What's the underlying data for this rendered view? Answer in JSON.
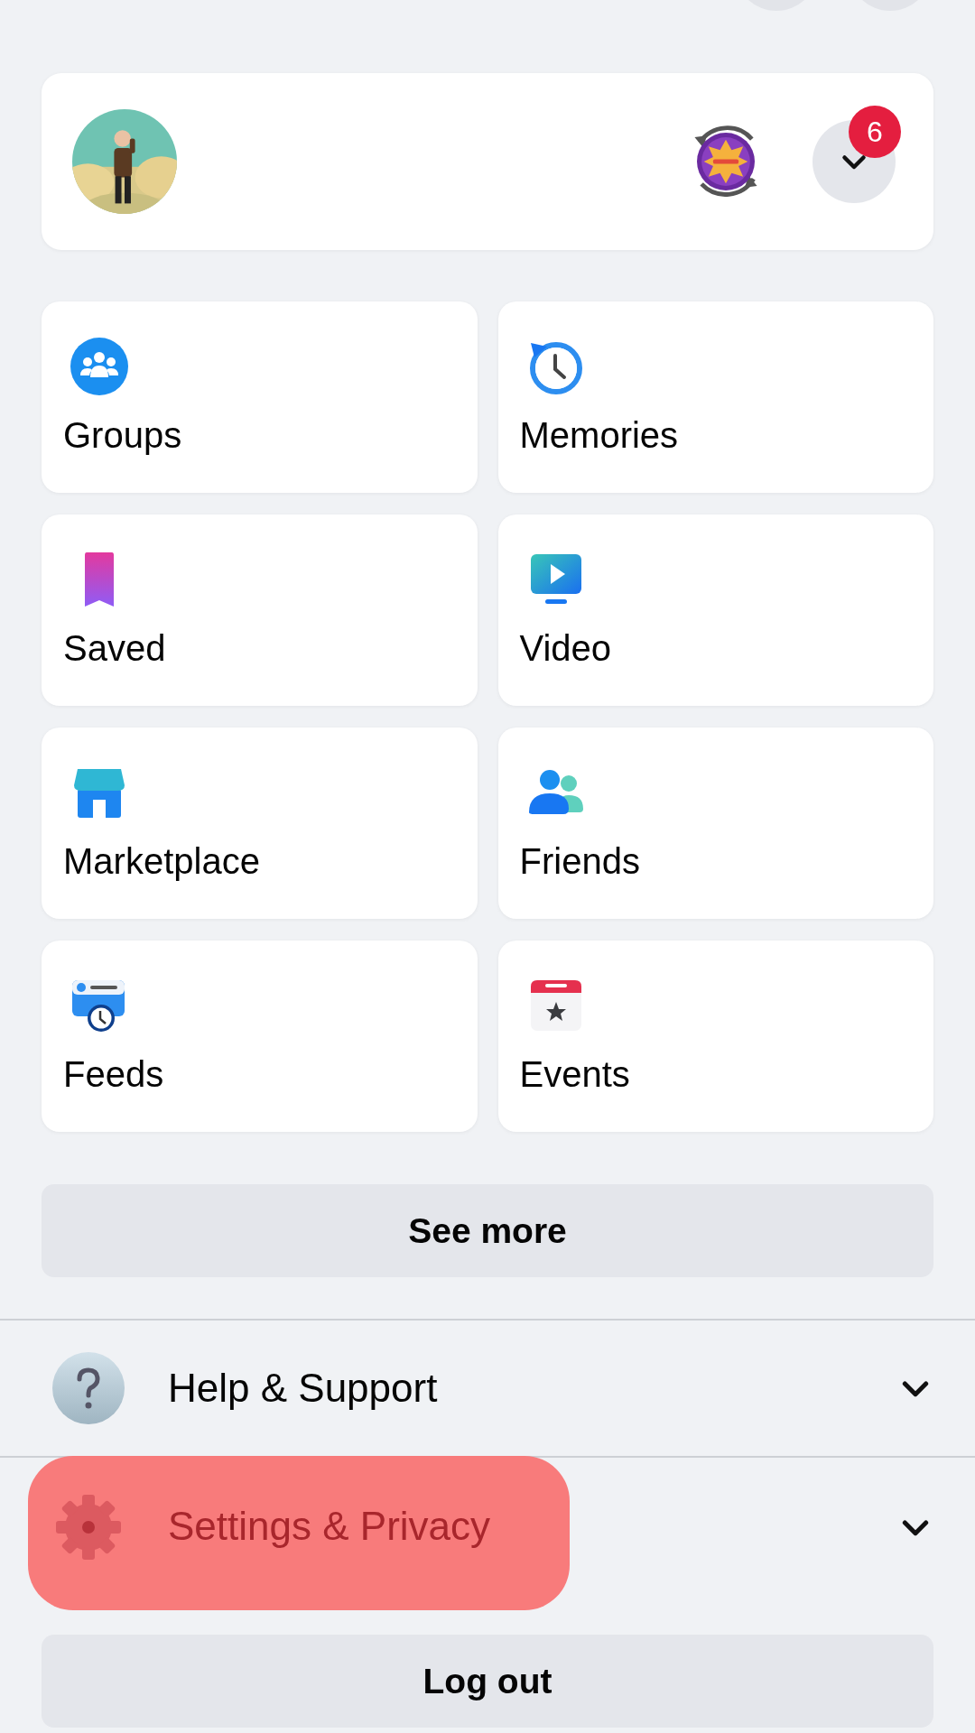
{
  "profile": {
    "badge": "6"
  },
  "shortcuts": [
    {
      "label": "Groups",
      "kind": "groups"
    },
    {
      "label": "Memories",
      "kind": "memories"
    },
    {
      "label": "Saved",
      "kind": "saved"
    },
    {
      "label": "Video",
      "kind": "video"
    },
    {
      "label": "Marketplace",
      "kind": "marketplace"
    },
    {
      "label": "Friends",
      "kind": "friends"
    },
    {
      "label": "Feeds",
      "kind": "feeds"
    },
    {
      "label": "Events",
      "kind": "events"
    }
  ],
  "see_more": "See more",
  "menu": [
    {
      "label": "Help & Support",
      "kind": "help",
      "expanded": false,
      "highlighted": false
    },
    {
      "label": "Settings & Privacy",
      "kind": "settings",
      "expanded": false,
      "highlighted": true
    }
  ],
  "logout": "Log out"
}
